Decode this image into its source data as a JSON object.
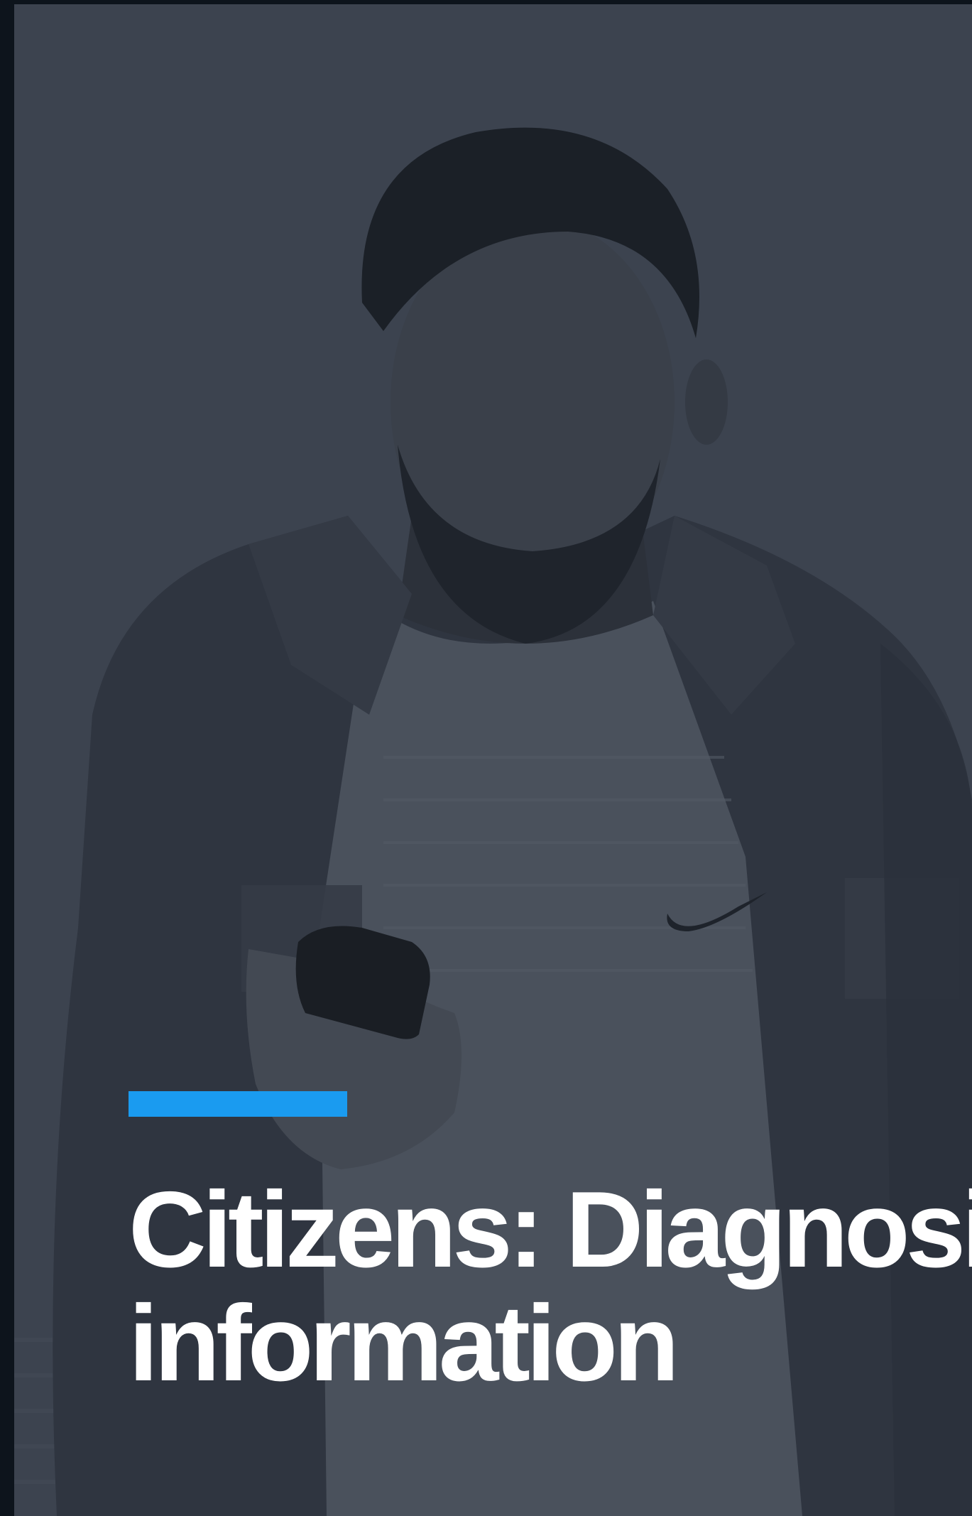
{
  "hero": {
    "image_description_name": "man-looking-at-phone-photo",
    "overlay_color": "#383f4a",
    "accent_color": "#1a9bf0"
  },
  "headline": {
    "line1": "Citizens: Diagnosis",
    "line2": "information"
  }
}
